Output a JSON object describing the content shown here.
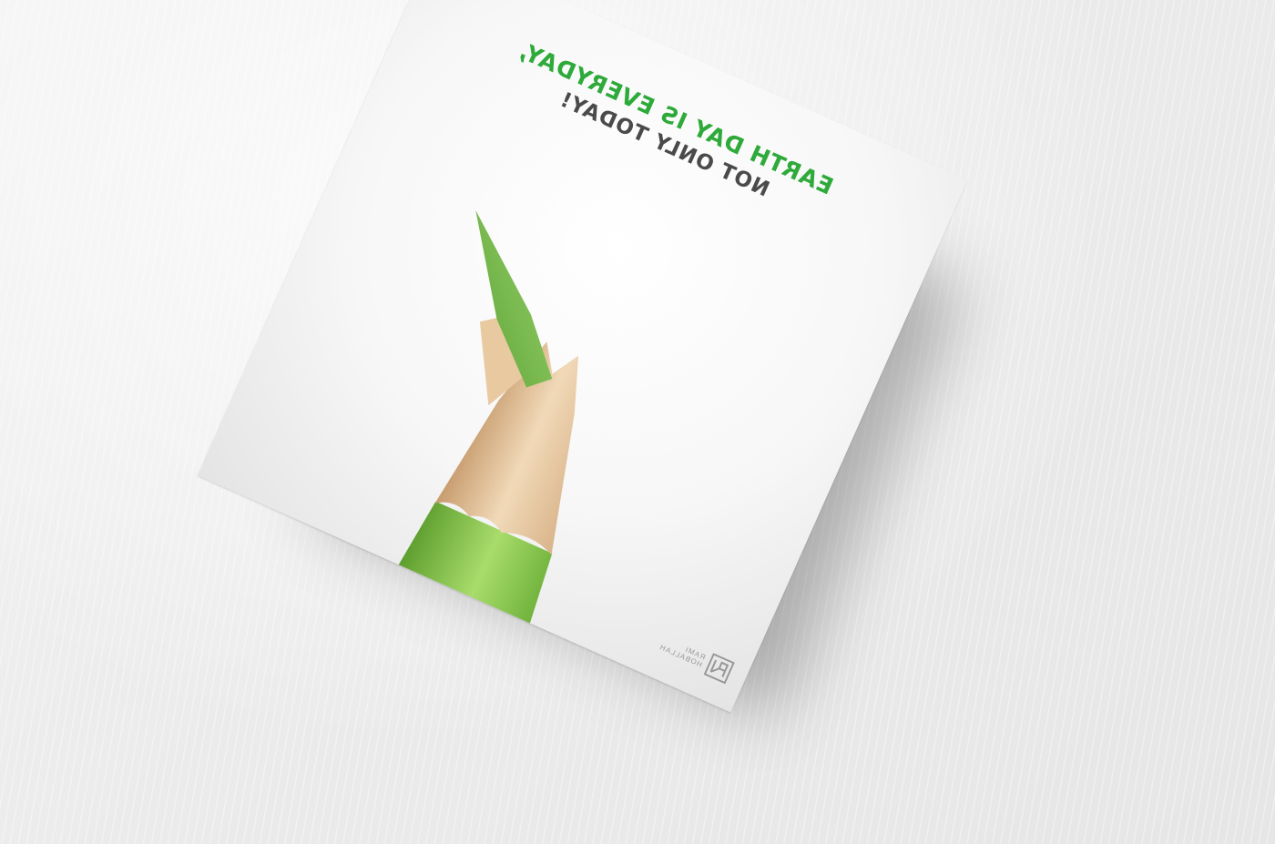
{
  "card": {
    "headline_line1": "EARTH DAY IS EVERYDAY,",
    "headline_line2": "NOT ONLY TODAY!",
    "mirrored": true
  },
  "logo": {
    "name_line1": "RAMI",
    "name_line2": "HOBALLAH",
    "icon": "rh-monogram-icon"
  },
  "colors": {
    "headline_green": "#2eaa3a",
    "headline_gray": "#4a4a4a",
    "pencil_green": "#7cc242",
    "wood": "#e7c9a2",
    "background": "#ececec"
  },
  "subject": {
    "object": "green-pencil-icon"
  }
}
